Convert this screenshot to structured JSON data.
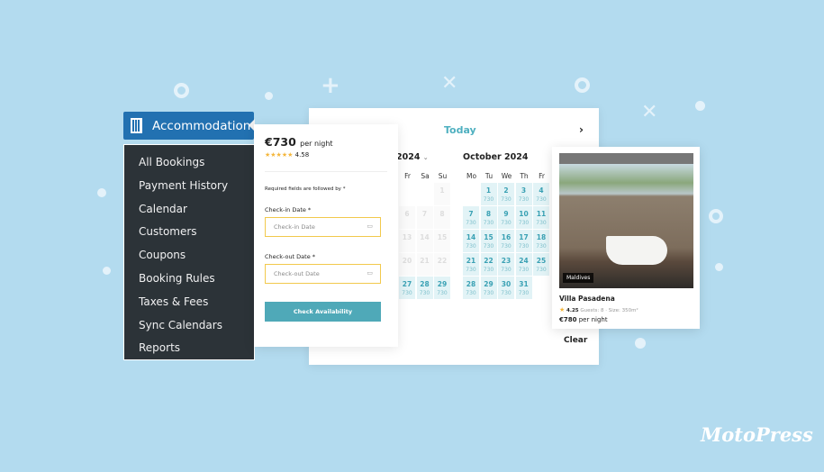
{
  "brand": "MotoPress",
  "admin_menu": {
    "header": "Accommodation",
    "header_icon": "building-icon",
    "items": [
      "All Bookings",
      "Payment History",
      "Calendar",
      "Customers",
      "Coupons",
      "Booking Rules",
      "Taxes & Fees",
      "Sync Calendars",
      "Reports"
    ]
  },
  "calendar": {
    "today_label": "Today",
    "next_icon": "chevron-right-icon",
    "clear_label": "Clear",
    "prev_month_title": "2024",
    "prev_month_weekdays": [
      "Fr",
      "Sa",
      "Su"
    ],
    "prev_month_days": [
      {
        "d": 1,
        "row": 0,
        "col": 2,
        "avail": false
      },
      {
        "d": 6,
        "row": 1,
        "col": 0,
        "avail": false
      },
      {
        "d": 7,
        "row": 1,
        "col": 1,
        "avail": false
      },
      {
        "d": 8,
        "row": 1,
        "col": 2,
        "avail": false
      },
      {
        "d": 13,
        "row": 2,
        "col": 0,
        "avail": false
      },
      {
        "d": 14,
        "row": 2,
        "col": 1,
        "avail": false
      },
      {
        "d": 15,
        "row": 2,
        "col": 2,
        "avail": false
      },
      {
        "d": 20,
        "row": 3,
        "col": 0,
        "avail": false
      },
      {
        "d": 21,
        "row": 3,
        "col": 1,
        "avail": false
      },
      {
        "d": 22,
        "row": 3,
        "col": 2,
        "avail": false
      },
      {
        "d": 27,
        "row": 4,
        "col": 0,
        "avail": true
      },
      {
        "d": 28,
        "row": 4,
        "col": 1,
        "avail": true
      },
      {
        "d": 29,
        "row": 4,
        "col": 2,
        "avail": true
      }
    ],
    "month_title": "October 2024",
    "weekdays": [
      "Mo",
      "Tu",
      "We",
      "Th",
      "Fr"
    ],
    "first_weekday": 1,
    "days_in_month": 31,
    "price": "730"
  },
  "booking_form": {
    "price": "€730",
    "per_night": "per night",
    "rating": "4.58",
    "stars": 4.5,
    "required_note": "Required fields are followed by *",
    "checkin_label": "Check-in Date *",
    "checkin_placeholder": "Check-in Date",
    "checkout_label": "Check-out Date *",
    "checkout_placeholder": "Check-out Date",
    "submit_label": "Check Availability"
  },
  "property": {
    "location_tag": "Maldives",
    "name": "Villa Pasadena",
    "rating": "4.25",
    "meta": "Guests: 8 · Size: 350m²",
    "price": "€780",
    "per_night": "per night"
  }
}
